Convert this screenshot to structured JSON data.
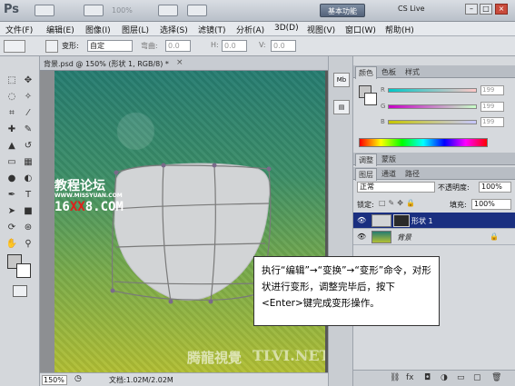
{
  "app": {
    "logo": "Ps",
    "zoom_select": "100%",
    "workspace_label": "基本功能",
    "cs_live": "CS Live"
  },
  "menu": {
    "items": [
      "文件(F)",
      "编辑(E)",
      "图像(I)",
      "图层(L)",
      "选择(S)",
      "滤镜(T)",
      "分析(A)",
      "3D(D)",
      "视图(V)",
      "窗口(W)",
      "帮助(H)"
    ]
  },
  "options": {
    "transform_label": "变形:",
    "transform_value": "自定",
    "bend_label": "弯曲:",
    "bend_value": "0.0",
    "h_label": "H:",
    "h_value": "0.0",
    "v_label": "V:",
    "v_value": "0.0"
  },
  "document": {
    "tab_title": "背景.psd @ 150% (形状 1, RGB/8) *",
    "zoom": "150%",
    "doc_info": "文档:1.02M/2.02M"
  },
  "watermarks": {
    "top_left_cn": "教程论坛",
    "top_left_url": "WWW.MISSYUAN.COM",
    "top_left_num": "16",
    "top_left_xx": "XX",
    "top_left_tail": "8.COM",
    "bottom_right": "TLVI.NET",
    "bottom_right_cn": "腾龍視覺"
  },
  "color_panel": {
    "tabs": [
      "颜色",
      "色板",
      "样式"
    ],
    "r": {
      "label": "R",
      "value": "199"
    },
    "g": {
      "label": "G",
      "value": "199"
    },
    "b": {
      "label": "B",
      "value": "199"
    }
  },
  "adjust_panel": {
    "tabs": [
      "调整",
      "蒙版"
    ]
  },
  "layers_panel": {
    "tabs": [
      "图层",
      "通道",
      "路径"
    ],
    "blend_mode": "正常",
    "opacity_label": "不透明度:",
    "opacity_value": "100%",
    "lock_label": "锁定:",
    "fill_label": "填充:",
    "fill_value": "100%",
    "layers": [
      {
        "name": "形状 1",
        "selected": true
      },
      {
        "name": "背景",
        "selected": false
      }
    ]
  },
  "callout": {
    "text": "执行“编辑”→“变换”→“变形”命令，对形状进行变形，调整完毕后，按下<Enter>键完成变形操作。"
  },
  "colors": {
    "selected_layer": "#1a2f80",
    "canvas_top": "#267c71",
    "canvas_bottom": "#b2bf34",
    "shape_fill": "#d2d4d6"
  }
}
